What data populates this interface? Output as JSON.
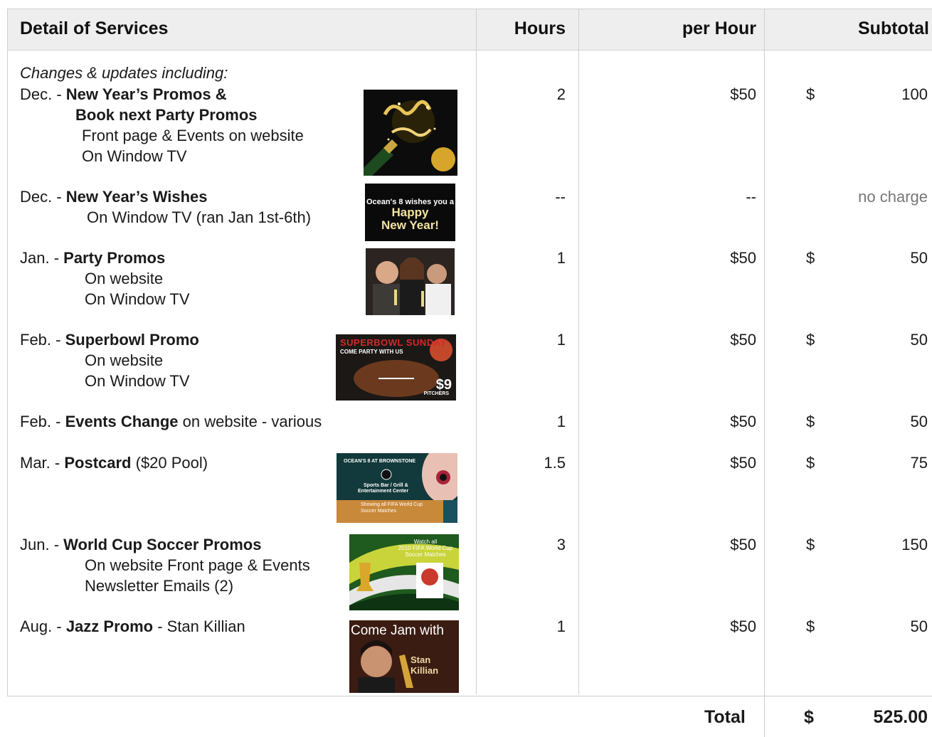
{
  "header": {
    "services": "Detail of Services",
    "hours": "Hours",
    "per_hour": "per Hour",
    "subtotal": "Subtotal"
  },
  "intro": "Changes & updates including:",
  "rows": [
    {
      "month": "Dec. - ",
      "title": "New Year’s Promos &",
      "title2": "Book next Party Promos",
      "lines": [
        "Front page & Events on website",
        "On Window TV"
      ],
      "hours": "2",
      "rate": "$50",
      "currency": "$",
      "subtotal": "100",
      "thumb_text": []
    },
    {
      "month": "Dec. - ",
      "title": "New Year’s Wishes",
      "lines": [
        "On Window TV (ran Jan 1st-6th)"
      ],
      "hours": "--",
      "rate": "--",
      "subtotal": "no charge",
      "thumb_text": [
        "Ocean's 8 wishes you a",
        "Happy",
        "New Year!"
      ]
    },
    {
      "month": "Jan.  - ",
      "title": "Party Promos",
      "lines": [
        "On website",
        "On Window TV"
      ],
      "hours": "1",
      "rate": "$50",
      "currency": "$",
      "subtotal": "50",
      "thumb_text": []
    },
    {
      "month": "Feb. - ",
      "title": "Superbowl Promo",
      "lines": [
        "On website",
        "On Window TV"
      ],
      "hours": "1",
      "rate": "$50",
      "currency": "$",
      "subtotal": "50",
      "thumb_text": [
        "SUPERBOWL SUNDAY",
        "COME PARTY WITH US",
        "$9",
        "PITCHERS"
      ]
    },
    {
      "month": "Feb. - ",
      "title": "Events Change",
      "after": " on website - various",
      "lines": [],
      "hours": "1",
      "rate": "$50",
      "currency": "$",
      "subtotal": "50",
      "thumb_text": []
    },
    {
      "month": "Mar. - ",
      "title": "Postcard",
      "after": " ($20 Pool)",
      "lines": [],
      "hours": "1.5",
      "rate": "$50",
      "currency": "$",
      "subtotal": "75",
      "thumb_text": [
        "OCEAN'S 8 AT BROWNSTONE",
        "Sports Bar / Grill &",
        "Entertainment Center",
        "Showing all FIFA World Cup",
        "Soccer Matches"
      ]
    },
    {
      "month": "Jun. - ",
      "title": "World Cup Soccer Promos",
      "lines": [
        "On website Front page & Events",
        "Newsletter Emails (2)"
      ],
      "hours": "3",
      "rate": "$50",
      "currency": "$",
      "subtotal": "150",
      "thumb_text": [
        "Watch all",
        "2010 FIFA World Cup",
        "Soccer Matches"
      ]
    },
    {
      "month": "Aug. - ",
      "title": "Jazz Promo",
      "after": " - Stan Killian",
      "lines": [],
      "hours": "1",
      "rate": "$50",
      "currency": "$",
      "subtotal": "50",
      "thumb_text": [
        "Come Jam with",
        "Stan Killian"
      ]
    }
  ],
  "total": {
    "label": "Total",
    "currency": "$",
    "value": "525.00"
  }
}
